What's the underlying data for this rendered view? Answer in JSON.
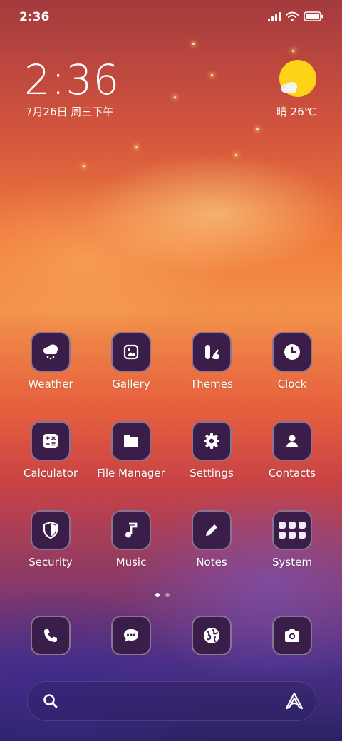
{
  "status_bar": {
    "time": "2:36",
    "icons": [
      "signal-icon",
      "wifi-icon",
      "battery-icon"
    ]
  },
  "clock_widget": {
    "time": "2:36",
    "date": "7月26日 周三下午"
  },
  "weather_widget": {
    "condition_icon": "sun-cloud-icon",
    "text": "晴 26℃"
  },
  "apps": [
    {
      "label": "Weather",
      "icon": "weather-icon"
    },
    {
      "label": "Gallery",
      "icon": "gallery-icon"
    },
    {
      "label": "Themes",
      "icon": "themes-icon"
    },
    {
      "label": "Clock",
      "icon": "clock-icon"
    },
    {
      "label": "Calculator",
      "icon": "calculator-icon"
    },
    {
      "label": "File Manager",
      "icon": "folder-icon"
    },
    {
      "label": "Settings",
      "icon": "gear-icon"
    },
    {
      "label": "Contacts",
      "icon": "person-icon"
    },
    {
      "label": "Security",
      "icon": "shield-icon"
    },
    {
      "label": "Music",
      "icon": "music-note-icon"
    },
    {
      "label": "Notes",
      "icon": "pencil-icon"
    },
    {
      "label": "System",
      "icon": "folder-grid-icon"
    }
  ],
  "page_indicator": {
    "pages": 2,
    "current": 1
  },
  "dock": [
    {
      "icon": "phone-icon"
    },
    {
      "icon": "message-icon"
    },
    {
      "icon": "browser-globe-icon"
    },
    {
      "icon": "camera-icon"
    }
  ],
  "search_bar": {
    "left_icon": "search-icon",
    "right_icon": "assistant-icon"
  },
  "colors": {
    "icon_bg": "#3b1d4a",
    "weather_sun": "#ffd21a"
  }
}
